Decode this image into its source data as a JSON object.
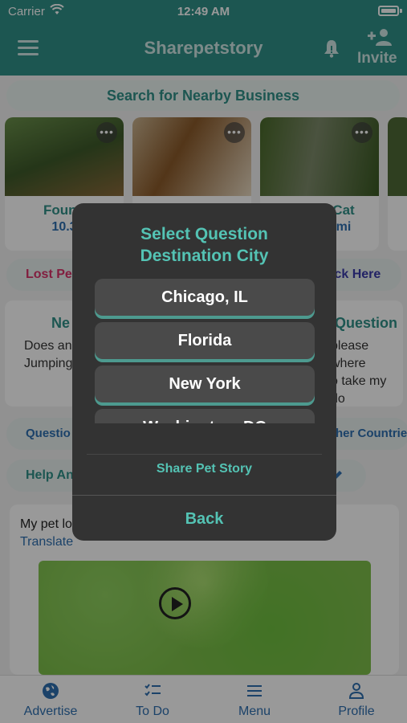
{
  "status_bar": {
    "carrier": "Carrier",
    "time": "12:49 AM"
  },
  "header": {
    "title": "Sharepetstory",
    "invite_label": "Invite"
  },
  "search": {
    "label": "Search for Nearby Business"
  },
  "cards": [
    {
      "line1": "Found",
      "line2": "10.3"
    },
    {
      "line1": "",
      "line2": ""
    },
    {
      "line1": "Cat",
      "line2": "mi"
    },
    {
      "line1": "",
      "line2": ""
    }
  ],
  "pills": {
    "lost_pet": "Lost Pet",
    "click_here": "ick Here",
    "question": "Questio",
    "other_countries": "her Countrie",
    "help": "Help An"
  },
  "panels": {
    "left_title": "Ne",
    "left_text": [
      "Does an",
      "Jumping"
    ],
    "right_title": "Question",
    "right_text": [
      "please where",
      "o take my do"
    ]
  },
  "post": {
    "text": "My pet lo",
    "translate": "Translate"
  },
  "tabs": [
    {
      "label": "Advertise",
      "icon": "globe-icon"
    },
    {
      "label": "To Do",
      "icon": "todo-list-icon"
    },
    {
      "label": "Menu",
      "icon": "menu-icon"
    },
    {
      "label": "Profile",
      "icon": "person-icon"
    }
  ],
  "dialog": {
    "title_line1": "Select Question",
    "title_line2": "Destination City",
    "options": [
      "Chicago, IL",
      "Florida",
      "New York",
      "Washington, DC"
    ],
    "share_label": "Share Pet Story",
    "back_label": "Back"
  },
  "colors": {
    "header": "#2f8f87",
    "accent": "#54c3b4",
    "dialog_bg": "#333333",
    "link": "#2e6fb0"
  }
}
